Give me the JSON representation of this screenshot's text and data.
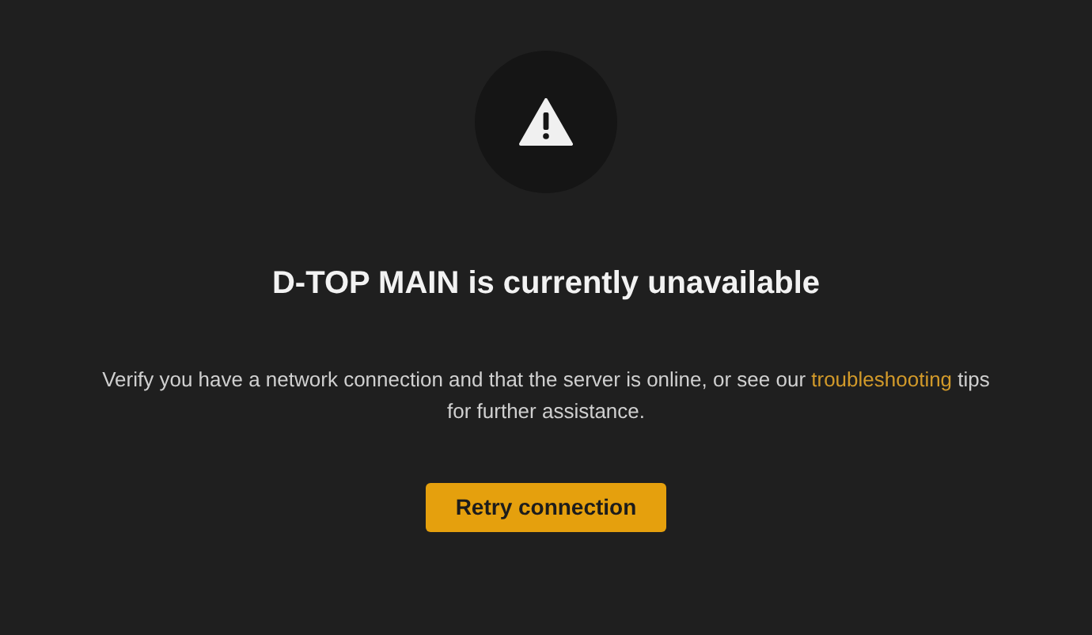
{
  "error": {
    "title": "D-TOP MAIN is currently unavailable",
    "message": {
      "before": "Verify you have a network connection and that the server is online, or see our ",
      "link": "troubleshooting",
      "after": " tips for further assistance."
    },
    "button": "Retry connection"
  }
}
